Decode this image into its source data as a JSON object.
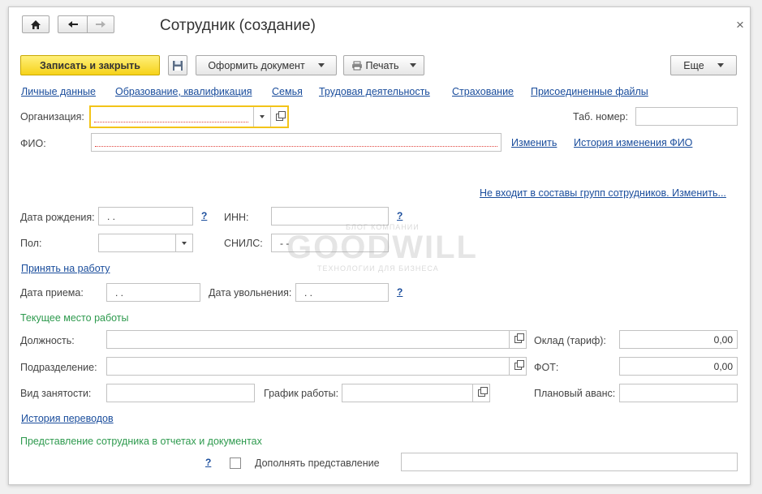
{
  "window": {
    "title": "Сотрудник (создание)",
    "close_glyph": "×"
  },
  "toolbar": {
    "save_close_label": "Записать и закрыть",
    "issue_document_label": "Оформить документ",
    "print_label": "Печать",
    "more_label": "Еще"
  },
  "nav_links": [
    "Личные данные",
    "Образование, квалификация",
    "Семья",
    "Трудовая деятельность",
    "Страхование",
    "Присоединенные файлы"
  ],
  "form": {
    "organization_label": "Организация:",
    "tab_number_label": "Таб. номер:",
    "fio_label": "ФИО:",
    "change_link": "Изменить",
    "fio_history_link": "История изменения ФИО",
    "groups_link": "Не входит в составы групп сотрудников. Изменить...",
    "birth_date_label": "Дата рождения:",
    "birth_date_value": " .  .",
    "inn_label": "ИНН:",
    "gender_label": "Пол:",
    "snils_label": "СНИЛС:",
    "snils_value": "-  -",
    "help_glyph": "?",
    "hire_link": "Принять на работу",
    "hire_date_label": "Дата приема:",
    "hire_date_value": " .  .",
    "dismissal_date_label": "Дата увольнения:",
    "dismissal_date_value": " .  .",
    "current_workplace_title": "Текущее место работы",
    "position_label": "Должность:",
    "salary_label": "Оклад (тариф):",
    "salary_value": "0,00",
    "department_label": "Подразделение:",
    "fot_label": "ФОТ:",
    "fot_value": "0,00",
    "employment_type_label": "Вид занятости:",
    "schedule_label": "График работы:",
    "planned_advance_label": "Плановый аванс:",
    "transfers_history_link": "История переводов",
    "representation_title": "Представление сотрудника в отчетах и документах",
    "supplement_label": "Дополнять представление"
  },
  "watermark": {
    "small_top": "БЛОГ КОМПАНИИ",
    "brand": "GOODWILL",
    "tagline": "ТЕХНОЛОГИИ ДЛЯ БИЗНЕСА"
  },
  "icons": [
    "home-icon",
    "back-arrow-icon",
    "forward-arrow-icon",
    "close-icon",
    "floppy-disk-icon",
    "printer-icon",
    "chevron-down-icon",
    "open-form-icon",
    "checkbox-icon"
  ]
}
